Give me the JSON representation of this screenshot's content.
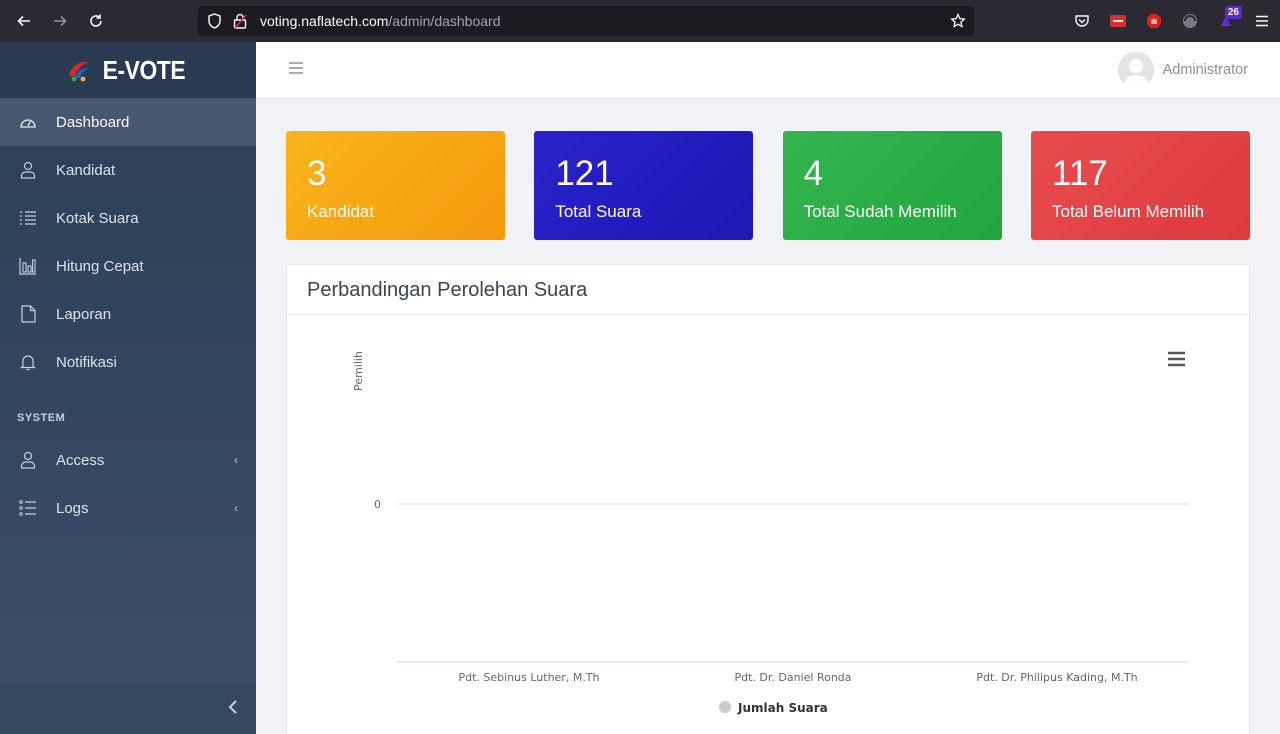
{
  "browser": {
    "url_host": "voting.naflatech.com",
    "url_path": "/admin/dashboard",
    "extension_badge": "26"
  },
  "sidebar": {
    "brand": "E-VOTE",
    "items": [
      {
        "label": "Dashboard",
        "icon": "gauge-icon",
        "active": true
      },
      {
        "label": "Kandidat",
        "icon": "user-icon"
      },
      {
        "label": "Kotak Suara",
        "icon": "list-icon"
      },
      {
        "label": "Hitung Cepat",
        "icon": "bar-chart-icon"
      },
      {
        "label": "Laporan",
        "icon": "document-icon"
      },
      {
        "label": "Notifikasi",
        "icon": "bell-icon"
      }
    ],
    "section_label": "SYSTEM",
    "system_items": [
      {
        "label": "Access",
        "icon": "user-icon"
      },
      {
        "label": "Logs",
        "icon": "list-icon"
      }
    ]
  },
  "header": {
    "user_name": "Administrator"
  },
  "cards": [
    {
      "value": "3",
      "label": "Kandidat",
      "color": "#f6a314"
    },
    {
      "value": "121",
      "label": "Total Suara",
      "color": "#241cbf"
    },
    {
      "value": "4",
      "label": "Total Sudah Memilih",
      "color": "#29ad46"
    },
    {
      "value": "117",
      "label": "Total Belum Memilih",
      "color": "#e04345"
    }
  ],
  "panel": {
    "title": "Perbandingan Perolehan Suara"
  },
  "chart_data": {
    "type": "bar",
    "title": "",
    "ylabel": "Pemilih",
    "xlabel": "",
    "categories": [
      "Pdt. Sebinus Luther, M.Th",
      "Pdt. Dr. Daniel Ronda",
      "Pdt. Dr. Philipus Kading, M.Th"
    ],
    "series": [
      {
        "name": "Jumlah Suara",
        "values": [
          0,
          0,
          0
        ],
        "color": "#cccccc"
      }
    ],
    "y_ticks": [
      "0"
    ],
    "legend": "bottom"
  }
}
